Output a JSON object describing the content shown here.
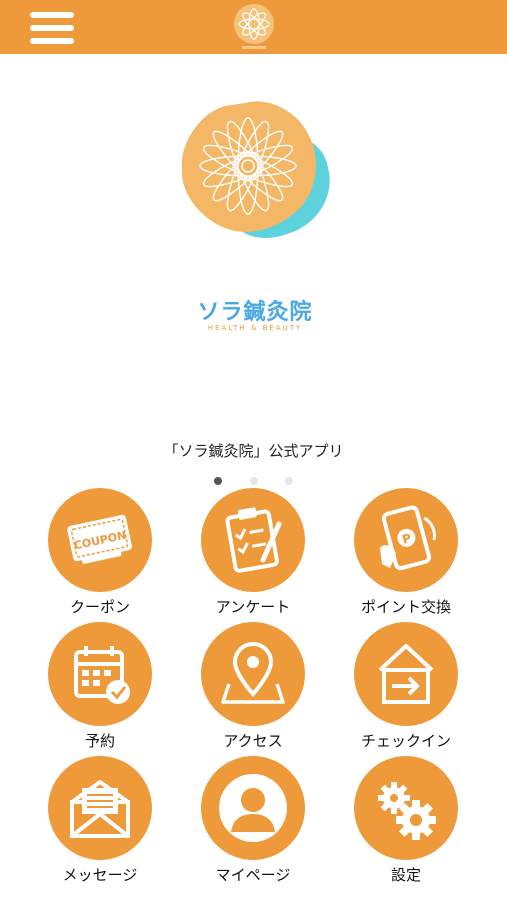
{
  "header": {
    "menu_icon": "hamburger-menu-icon",
    "logo_icon": "lotus-logo-icon"
  },
  "hero": {
    "brand_name": "ソラ鍼灸院",
    "brand_sub": "HEALTH & BEAUTY",
    "tagline": "「ソラ鍼灸院」公式アプリ",
    "slides": 3,
    "active_slide": 1
  },
  "menu": {
    "items": [
      {
        "label": "クーポン",
        "icon": "coupon-icon",
        "badge_text": "COUPON"
      },
      {
        "label": "アンケート",
        "icon": "survey-clipboard-icon"
      },
      {
        "label": "ポイント交換",
        "icon": "point-exchange-icon"
      },
      {
        "label": "予約",
        "icon": "calendar-check-icon"
      },
      {
        "label": "アクセス",
        "icon": "map-pin-icon"
      },
      {
        "label": "チェックイン",
        "icon": "check-in-door-icon"
      },
      {
        "label": "メッセージ",
        "icon": "envelope-icon"
      },
      {
        "label": "マイページ",
        "icon": "user-icon"
      },
      {
        "label": "設定",
        "icon": "gear-icon"
      }
    ]
  },
  "colors": {
    "accent": "#ee9a3a",
    "brand_text": "#4ba8e6",
    "logo_teal": "#5cd3dc",
    "logo_orange": "#f3b765"
  }
}
